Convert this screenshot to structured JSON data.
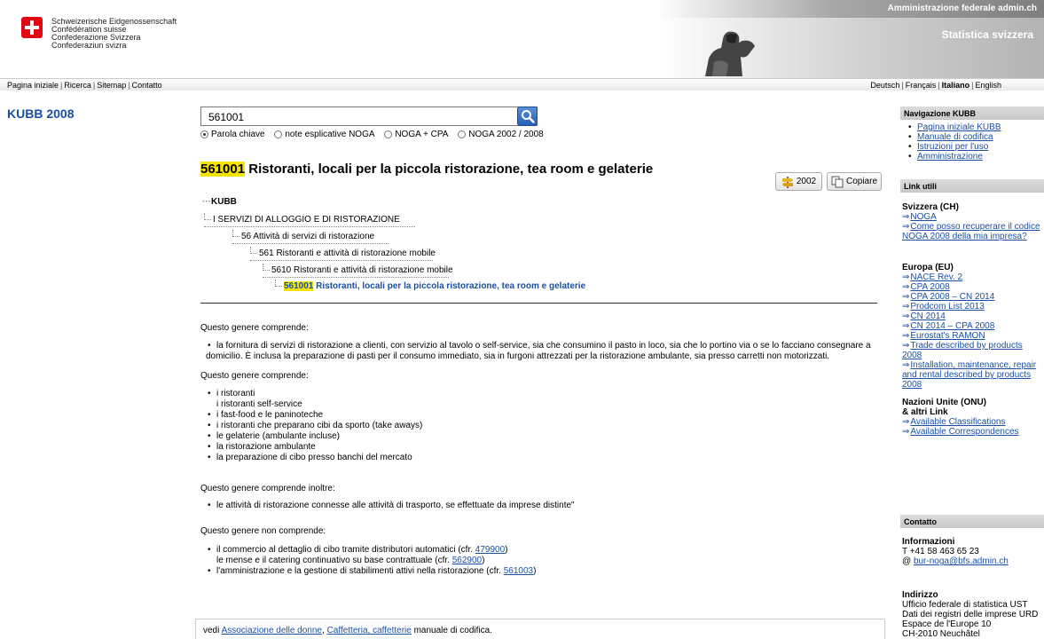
{
  "header": {
    "confed_lines": [
      "Schweizerische Eidgenossenschaft",
      "Confédération suisse",
      "Confederazione Svizzera",
      "Confederaziun svizra"
    ],
    "admin_label": "Amministrazione federale admin.ch",
    "stat_label": "Statistica svizzera"
  },
  "topnav": {
    "left": [
      "Pagina iniziale",
      "Ricerca",
      "Sitemap",
      "Contatto"
    ],
    "right": [
      "Deutsch",
      "Français",
      "Italiano",
      "English"
    ],
    "active_lang": "Italiano"
  },
  "left": {
    "title": "KUBB 2008"
  },
  "search": {
    "value": "561001",
    "options": [
      {
        "label": "Parola chiave",
        "selected": true
      },
      {
        "label": "note esplicative NOGA",
        "selected": false
      },
      {
        "label": "NOGA + CPA",
        "selected": false
      },
      {
        "label": "NOGA 2002 / 2008",
        "selected": false
      }
    ]
  },
  "entry": {
    "code": "561001",
    "title": "Ristoranti, locali per la piccola ristorazione, tea room e gelaterie",
    "btn_2002": "2002",
    "btn_copy": "Copiare"
  },
  "tree": {
    "root": "KUBB",
    "levels": [
      "I SERVIZI DI ALLOGGIO E DI RISTORAZIONE",
      "56 Attività di servizi di ristorazione",
      "561 Ristoranti e attività di ristorazione mobile",
      "5610 Ristoranti e attività di ristorazione mobile"
    ],
    "current_code": "561001",
    "current_label": "Ristoranti, locali per la piccola ristorazione, tea room e gelaterie"
  },
  "sections": {
    "comprende1_head": "Questo genere comprende:",
    "comprende1_items": [
      "la fornitura di servizi di ristorazione a clienti, con servizio al tavolo o self-service, sia che consumino il pasto in loco, sia che lo portino via o se lo facciano consegnare a",
      "domicilio. È inclusa la preparazione di pasti per il consumo immediato, sia in furgoni attrezzati per la ristorazione ambulante, sia presso carretti non motorizzati."
    ],
    "comprende2_head": "Questo genere comprende:",
    "comprende2_items": [
      "i ristoranti",
      "i ristoranti self-service",
      "i fast-food e le paninoteche",
      "i ristoranti che preparano cibi da sporto (take aways)",
      "le gelaterie (ambulante incluse)",
      "la ristorazione ambulante",
      "la preparazione di cibo presso banchi del mercato"
    ],
    "inoltre_head": "Questo genere comprende inoltre:",
    "inoltre_items": [
      "le attività di ristorazione connesse alle attività di trasporto, se effettuate da imprese distinte\""
    ],
    "non_head": "Questo genere non comprende:",
    "non_items": [
      {
        "text": "il commercio al dettaglio di cibo tramite distributori automatici (cfr. ",
        "link": "479900",
        "end": ")"
      },
      {
        "text": "le mense e il catering continuativo su base contrattuale (cfr. ",
        "link": "562900",
        "end": ")"
      },
      {
        "text": "l'amministrazione e la gestione di stabilimenti attivi nella ristorazione (cfr. ",
        "link": "561003",
        "end": ")"
      }
    ]
  },
  "footer": {
    "prefix": "vedi ",
    "link1": "Associazione delle donne",
    "comma": ", ",
    "link2": "Caffetteria, caffetterie",
    "suffix": " manuale di codifica."
  },
  "sidebar": {
    "nav_head": "Navigazione KUBB",
    "nav_items": [
      "Pagina iniziale KUBB",
      "Manuale di codifica",
      "Istruzioni per l'uso",
      "Amministrazione"
    ],
    "links_head": "Link utili",
    "ch_title": "Svizzera (CH)",
    "ch_links": [
      "NOGA",
      "Come posso recuperare il codice NOGA 2008 della mia impresa?"
    ],
    "eu_title": "Europa (EU)",
    "eu_links": [
      "NACE Rev. 2",
      "CPA 2008",
      "CPA 2008 – CN 2014",
      "Prodcom List 2013",
      "CN 2014",
      "CN 2014 – CPA 2008",
      "Eurostat's RAMON",
      "Trade described by products 2008",
      "Installation, maintenance, repair and rental described by products 2008"
    ],
    "un_title1": "Nazioni Unite (ONU)",
    "un_title2": "& altri Link",
    "un_links": [
      "Available Classifications",
      "Available Correspondences"
    ],
    "contact_head": "Contatto",
    "info_title": "Informazioni",
    "phone": "T +41 58 463 65 23",
    "email_prefix": "@ ",
    "email": "bur-noga@bfs.admin.ch",
    "addr_title": "Indirizzo",
    "addr_lines": [
      "Ufficio federale di statistica UST",
      "Dati dei registri delle imprese URD",
      "Espace de l'Europe 10",
      "CH-2010 Neuchâtel"
    ]
  }
}
